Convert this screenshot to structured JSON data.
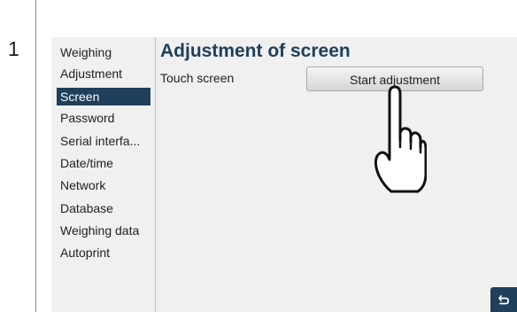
{
  "step": {
    "number": "1"
  },
  "sidebar": {
    "items": [
      {
        "label": "Weighing",
        "active": false
      },
      {
        "label": "Adjustment",
        "active": false
      },
      {
        "label": "Screen",
        "active": true
      },
      {
        "label": "Password",
        "active": false
      },
      {
        "label": "Serial interfa...",
        "active": false
      },
      {
        "label": "Date/time",
        "active": false
      },
      {
        "label": "Network",
        "active": false
      },
      {
        "label": "Database",
        "active": false
      },
      {
        "label": "Weighing data",
        "active": false
      },
      {
        "label": "Autoprint",
        "active": false
      }
    ]
  },
  "main": {
    "title": "Adjustment of screen",
    "row_label": "Touch screen",
    "start_button_label": "Start adjustment"
  },
  "icons": {
    "back": "back-arrow-icon",
    "hand": "pointing-hand-icon"
  },
  "colors": {
    "accent": "#1f3f5b",
    "screen_background": "#f0f0f0"
  }
}
